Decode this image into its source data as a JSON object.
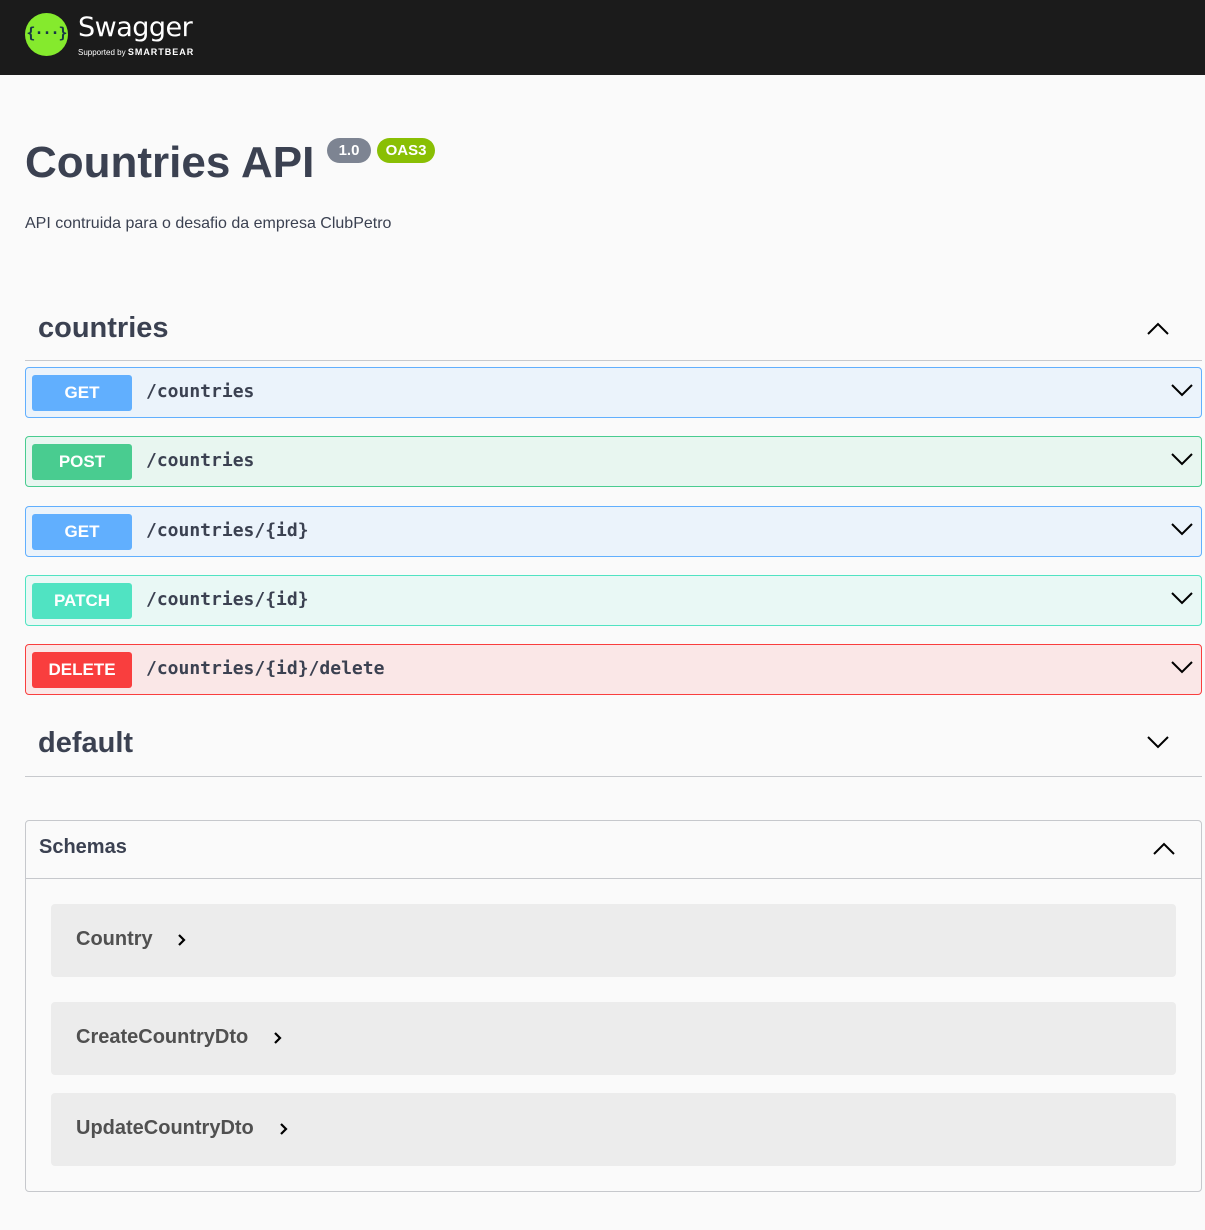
{
  "topbar": {
    "logo_glyph": "{···}",
    "logo_title": "Swagger",
    "logo_sub_prefix": "Supported by ",
    "logo_sub_brand": "SMARTBEAR"
  },
  "info": {
    "title": "Countries API",
    "version": "1.0",
    "oas_badge": "OAS3",
    "description": "API contruida para o desafio da empresa ClubPetro"
  },
  "tags": [
    {
      "name": "countries",
      "expanded": true,
      "operations": [
        {
          "method": "GET",
          "path": "/countries"
        },
        {
          "method": "POST",
          "path": "/countries"
        },
        {
          "method": "GET",
          "path": "/countries/{id}"
        },
        {
          "method": "PATCH",
          "path": "/countries/{id}"
        },
        {
          "method": "DELETE",
          "path": "/countries/{id}/delete"
        }
      ]
    },
    {
      "name": "default",
      "expanded": false,
      "operations": []
    }
  ],
  "schemas": {
    "title": "Schemas",
    "expanded": true,
    "models": [
      "Country",
      "CreateCountryDto",
      "UpdateCountryDto"
    ]
  },
  "colors": {
    "get": "#61affe",
    "post": "#49cc90",
    "patch": "#50e3c2",
    "delete": "#f93e3e",
    "logo": "#85ea2d",
    "oas": "#89bf04"
  }
}
